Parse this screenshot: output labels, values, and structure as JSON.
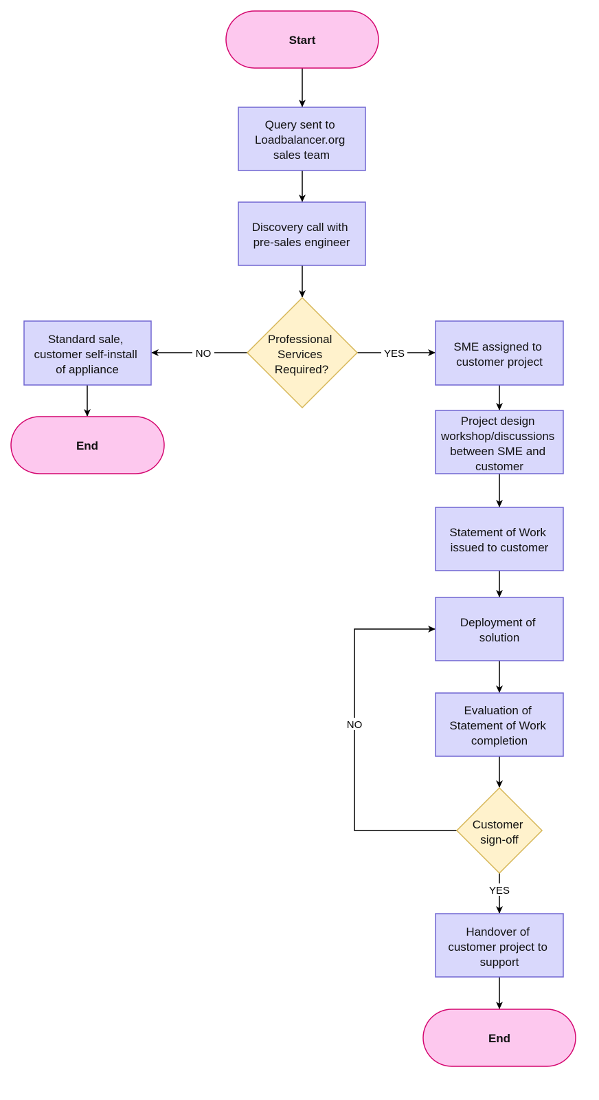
{
  "colors": {
    "terminal_fill": "#fdc8ee",
    "terminal_stroke": "#d4066f",
    "process_fill": "#d9d8fc",
    "process_stroke": "#7066d2",
    "decision_fill": "#fff2cc",
    "decision_stroke": "#d6b656"
  },
  "nodes": {
    "start": {
      "lines": [
        "Start"
      ]
    },
    "query": {
      "lines": [
        "Query sent to",
        "Loadbalancer.org",
        "sales team"
      ]
    },
    "discovery": {
      "lines": [
        "Discovery call with",
        "pre-sales engineer"
      ]
    },
    "ps_required": {
      "lines": [
        "Professional",
        "Services",
        "Required?"
      ]
    },
    "standard_sale": {
      "lines": [
        "Standard sale,",
        "customer self-install",
        "of appliance"
      ]
    },
    "end_left": {
      "lines": [
        "End"
      ]
    },
    "sme_assigned": {
      "lines": [
        "SME assigned to",
        "customer project"
      ]
    },
    "design_workshop": {
      "lines": [
        "Project design",
        "workshop/discussions",
        "between SME and",
        "customer"
      ]
    },
    "sow_issued": {
      "lines": [
        "Statement of Work",
        "issued to customer"
      ]
    },
    "deployment": {
      "lines": [
        "Deployment of",
        "solution"
      ]
    },
    "evaluation": {
      "lines": [
        "Evaluation of",
        "Statement of Work",
        "completion"
      ]
    },
    "signoff": {
      "lines": [
        "Customer",
        "sign-off"
      ]
    },
    "handover": {
      "lines": [
        "Handover of",
        "customer project to",
        "support"
      ]
    },
    "end_right": {
      "lines": [
        "End"
      ]
    }
  },
  "edges": {
    "ps_no": "NO",
    "ps_yes": "YES",
    "signoff_no": "NO",
    "signoff_yes": "YES"
  }
}
